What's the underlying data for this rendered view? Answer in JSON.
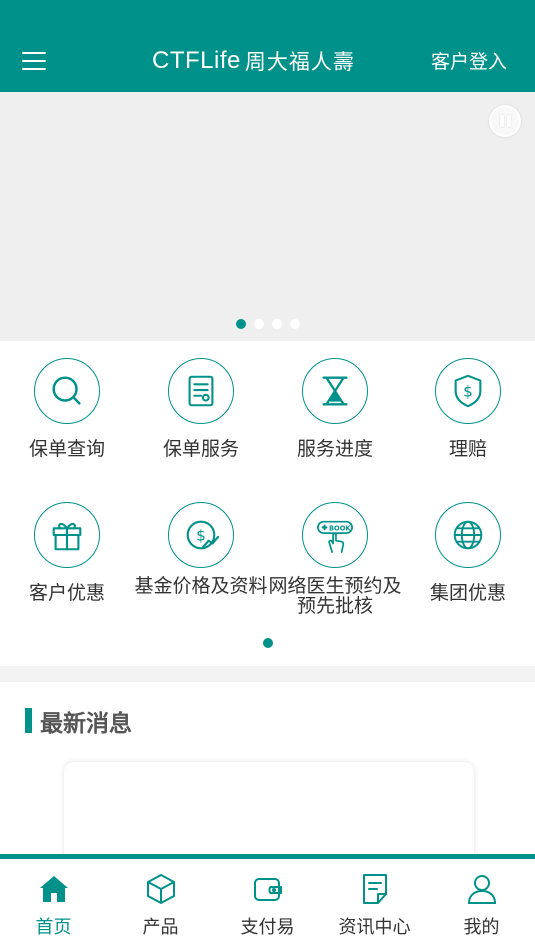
{
  "colors": {
    "brand": "#00928a",
    "background": "#f3f3f3"
  },
  "header": {
    "brand_latin": "CTFLife",
    "brand_cn": "周大福人壽",
    "login_label": "客户登入",
    "menu_icon": "hamburger-menu-icon"
  },
  "banner": {
    "slide_count": 4,
    "active_slide": 1,
    "pause_icon": "pause-icon"
  },
  "quick_links": [
    {
      "label": "保单查询",
      "icon": "search-icon"
    },
    {
      "label": "保单服务",
      "icon": "document-icon"
    },
    {
      "label": "服务进度",
      "icon": "hourglass-icon"
    },
    {
      "label": "理赔",
      "icon": "shield-dollar-icon"
    },
    {
      "label": "客户优惠",
      "icon": "gift-icon"
    },
    {
      "label": "基金价格及资料",
      "icon": "dollar-chart-icon"
    },
    {
      "label": "网络医生预约及预先批核",
      "icon": "book-appointment-icon",
      "badge": "BOOK"
    },
    {
      "label": "集团优惠",
      "icon": "globe-icon"
    }
  ],
  "quick_pages": {
    "count": 1,
    "active": 1
  },
  "news": {
    "title": "最新消息"
  },
  "bottom_nav": [
    {
      "label": "首页",
      "icon": "home-icon",
      "active": true
    },
    {
      "label": "产品",
      "icon": "product-box-icon",
      "active": false
    },
    {
      "label": "支付易",
      "icon": "wallet-icon",
      "active": false
    },
    {
      "label": "资讯中心",
      "icon": "news-document-icon",
      "active": false
    },
    {
      "label": "我的",
      "icon": "user-icon",
      "active": false
    }
  ]
}
